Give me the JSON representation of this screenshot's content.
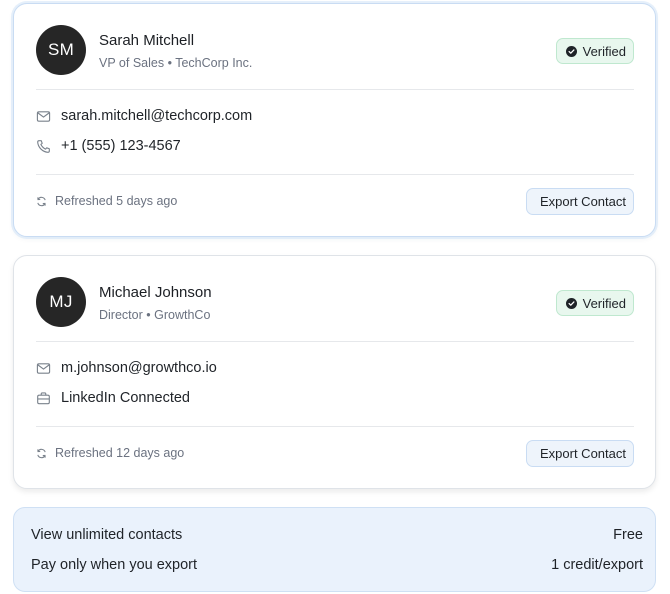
{
  "contacts": [
    {
      "initials": "SM",
      "name": "Sarah Mitchell",
      "role": "VP of Sales",
      "company": "TechCorp Inc.",
      "badge": "Verified",
      "rows": [
        {
          "icon": "mail-icon",
          "text": "sarah.mitchell@techcorp.com"
        },
        {
          "icon": "phone-icon",
          "text": "+1 (555) 123-4567"
        }
      ],
      "refreshed": "Refreshed 5 days ago",
      "export_label": "Export Contact"
    },
    {
      "initials": "MJ",
      "name": "Michael Johnson",
      "role": "Director",
      "company": "GrowthCo",
      "badge": "Verified",
      "rows": [
        {
          "icon": "mail-icon",
          "text": "m.johnson@growthco.io"
        },
        {
          "icon": "briefcase-icon",
          "text": "LinkedIn Connected"
        }
      ],
      "refreshed": "Refreshed 12 days ago",
      "export_label": "Export Contact"
    }
  ],
  "role_separator": "•",
  "pricing": {
    "rows": [
      {
        "label": "View unlimited contacts",
        "value": "Free"
      },
      {
        "label": "Pay only when you export",
        "value": "1 credit/export"
      }
    ]
  },
  "colors": {
    "avatar_bg": "#262626",
    "verified_bg": "#e8f7ee",
    "verified_border": "#bfe8cf",
    "button_bg": "#eef4fb",
    "pricing_bg": "#eaf2fc"
  }
}
